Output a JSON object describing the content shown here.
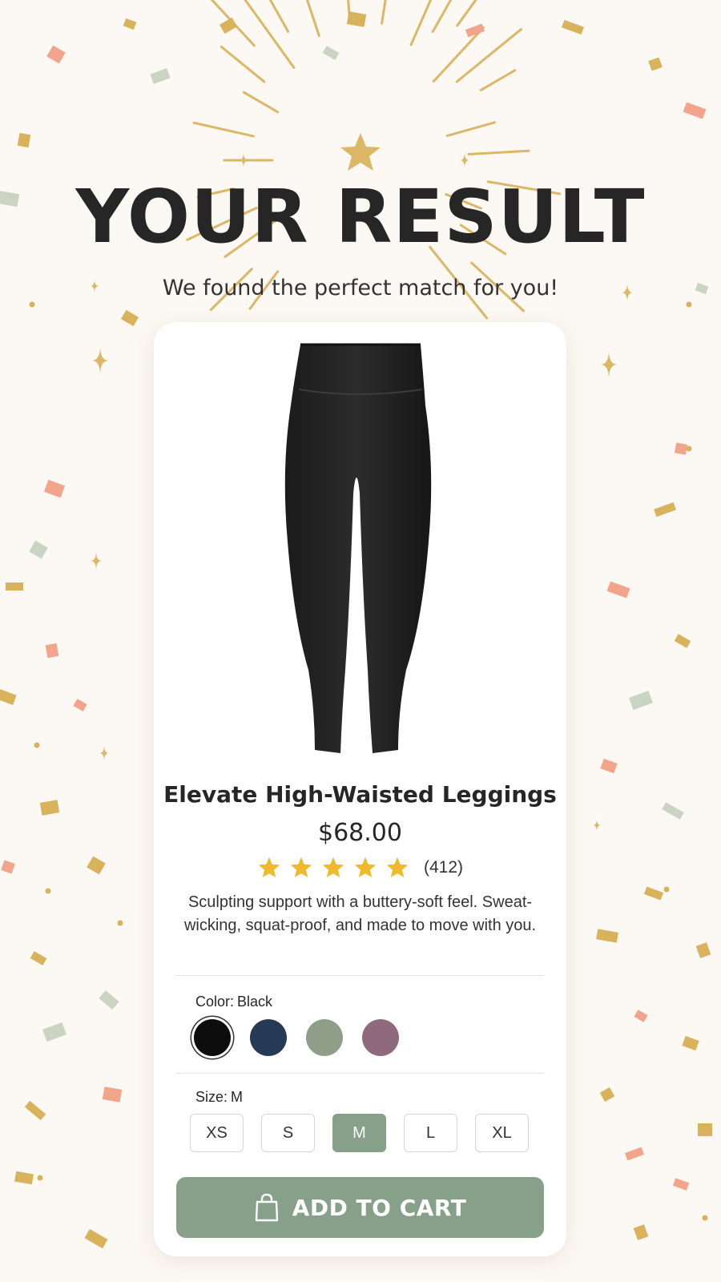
{
  "header": {
    "title": "YOUR RESULT",
    "subtitle": "We found the perfect match for you!"
  },
  "product": {
    "name": "Elevate High-Waisted Leggings",
    "price": "$68.00",
    "rating_stars": 5,
    "review_count": "(412)",
    "description": "Sculpting support with a buttery-soft feel. Sweat-wicking, squat-proof, and made to move with you.",
    "image_icon": "leggings-image"
  },
  "color": {
    "label": "Color:",
    "selected": "Black",
    "swatches": [
      {
        "name": "black",
        "hex": "#0d0d0d",
        "selected": true
      },
      {
        "name": "navy",
        "hex": "#263a56",
        "selected": false
      },
      {
        "name": "sage",
        "hex": "#8f9e88",
        "selected": false
      },
      {
        "name": "mauve",
        "hex": "#8f6a7c",
        "selected": false
      }
    ]
  },
  "size": {
    "label": "Size:",
    "selected": "M",
    "options": [
      "XS",
      "S",
      "M",
      "L",
      "XL"
    ]
  },
  "cart": {
    "label": "ADD TO CART",
    "icon": "shopping-bag-icon"
  },
  "colors": {
    "accent": "#86a089",
    "gold": "#d9b25c",
    "star": "#f0b92c",
    "background": "#fcf8f3"
  }
}
